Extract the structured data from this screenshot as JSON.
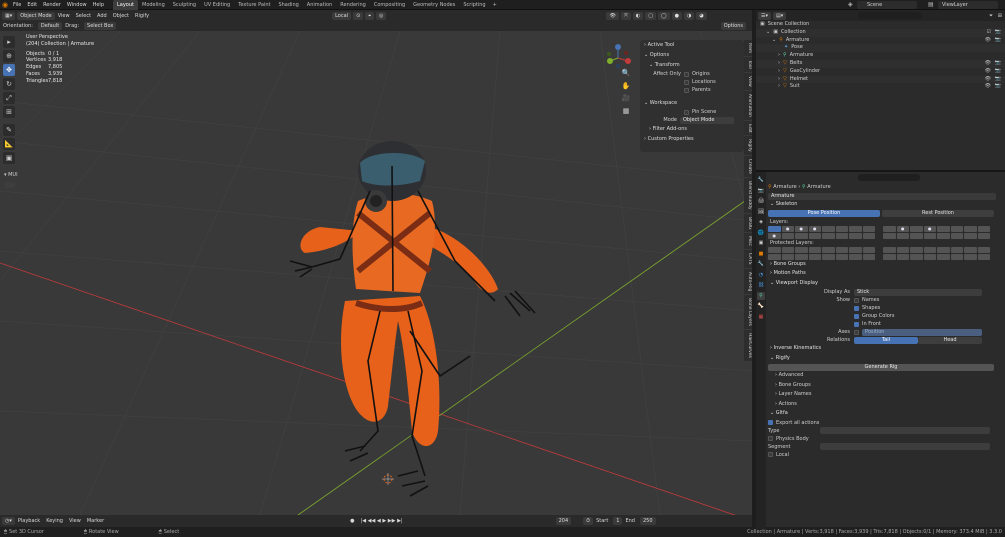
{
  "topbar": {
    "menus": [
      "File",
      "Edit",
      "Render",
      "Window",
      "Help"
    ],
    "workspaces": [
      "Layout",
      "Modeling",
      "Sculpting",
      "UV Editing",
      "Texture Paint",
      "Shading",
      "Animation",
      "Rendering",
      "Compositing",
      "Geometry Nodes",
      "Scripting"
    ],
    "active_workspace": "Layout",
    "add_tab": "+",
    "scene": "Scene",
    "view_layer": "ViewLayer"
  },
  "viewport_header": {
    "mode": "Object Mode",
    "menus": [
      "View",
      "Select",
      "Add",
      "Object",
      "Rigify"
    ],
    "transform_orientation": "Local",
    "options_label": "Options",
    "orientation_label": "Orientation:",
    "orientation_value": "Default",
    "drag_label": "Drag:",
    "drag_value": "Select Box"
  },
  "viewport_overlay": {
    "view_name": "User Perspective",
    "collection_info": "(204) Collection | Armature",
    "stats": [
      {
        "k": "Objects",
        "v": "0 / 1"
      },
      {
        "k": "Vertices",
        "v": "3,918"
      },
      {
        "k": "Edges",
        "v": "7,805"
      },
      {
        "k": "Faces",
        "v": "3,939"
      },
      {
        "k": "Triangles",
        "v": "7,818"
      }
    ]
  },
  "npanel": {
    "active_tool": "Active Tool",
    "options": "Options",
    "transform": "Transform",
    "affect_only": "Affect Only",
    "affect_items": [
      "Origins",
      "Locations",
      "Parents"
    ],
    "workspace": "Workspace",
    "pin_scene": "Pin Scene",
    "mode_label": "Mode",
    "mode_value": "Object Mode",
    "filter_addons": "Filter Add-ons",
    "custom_properties": "Custom Properties"
  },
  "sidebar_tabs": [
    "Item",
    "Tool",
    "View",
    "Animation",
    "Edit",
    "Rigify",
    "Create",
    "Blend Buddy",
    "BKBG",
    "Misc",
    "CATS",
    "Auto-Rig",
    "Bone Layers",
    "HairCurves"
  ],
  "timeline": {
    "menus": [
      "Playback",
      "Keying",
      "View",
      "Marker"
    ],
    "current_frame": "204",
    "start_label": "Start",
    "start": "1",
    "end_label": "End",
    "end": "250"
  },
  "statusbar": {
    "left_items": [
      "Set 3D Cursor",
      "Rotate View",
      "Select"
    ],
    "right_text": "Collection | Armature | Verts:3,918 | Faces:3,939 | Tris:7,818 | Objects:0/1 | Memory: 373.4 MiB | 3.3.0"
  },
  "outliner": {
    "root": "Scene Collection",
    "rows": [
      {
        "name": "Collection",
        "indent": 1
      },
      {
        "name": "Armature",
        "indent": 2
      },
      {
        "name": "Pose",
        "indent": 3
      },
      {
        "name": "Armature",
        "indent": 3
      },
      {
        "name": "Belts",
        "indent": 2
      },
      {
        "name": "GasCylinder",
        "indent": 2
      },
      {
        "name": "Helmet",
        "indent": 2
      },
      {
        "name": "Suit",
        "indent": 2
      }
    ]
  },
  "properties": {
    "breadcrumb_a": "Armature",
    "breadcrumb_b": "Armature",
    "datablock": "Armature",
    "skeleton": "Skeleton",
    "pose_position": "Pose Position",
    "rest_position": "Rest Position",
    "layers_label": "Layers:",
    "protected_layers_label": "Protected Layers:",
    "bone_groups": "Bone Groups",
    "motion_paths": "Motion Paths",
    "viewport_display": "Viewport Display",
    "display_as_label": "Display As",
    "display_as_value": "Stick",
    "show_label": "Show",
    "show_items": [
      {
        "label": "Names",
        "on": false
      },
      {
        "label": "Shapes",
        "on": true
      },
      {
        "label": "Group Colors",
        "on": true
      },
      {
        "label": "In Front",
        "on": true
      }
    ],
    "axes_label": "Axes",
    "axes_value": "Position",
    "relations_label": "Relations",
    "tail": "Tail",
    "head": "Head",
    "inverse_kinematics": "Inverse Kinematics",
    "rigify": "Rigify",
    "generate_rig": "Generate Rig",
    "rigify_subs": [
      "Advanced",
      "Bone Groups",
      "Layer Names",
      "Actions"
    ],
    "gltf": "Gltfa",
    "export_all_actions": "Export all actions",
    "type_label": "Type",
    "physics_body": "Physics Body",
    "segment_label": "Segment",
    "local_label": "Local"
  },
  "colors": {
    "accent": "#4772b3",
    "suit": "#e8611a",
    "axis_x": "#c33a3a",
    "axis_y": "#7fae2c"
  }
}
